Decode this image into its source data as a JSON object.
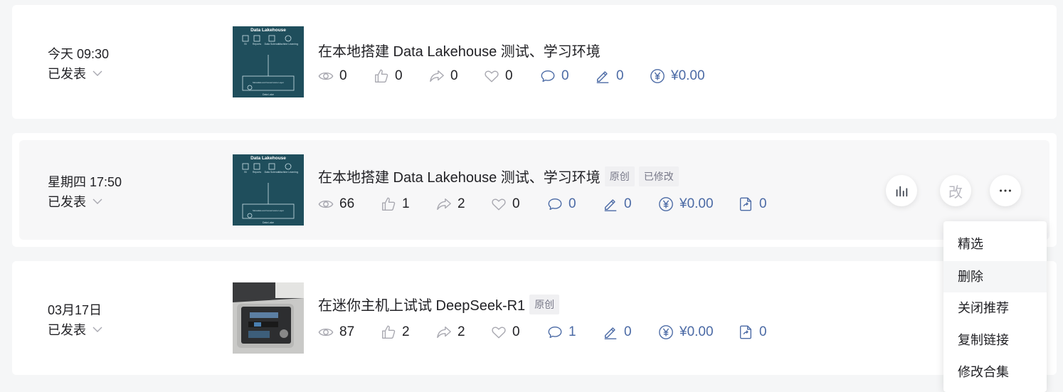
{
  "articles": [
    {
      "date": "今天 09:30",
      "status": "已发表",
      "title": "在本地搭建 Data Lakehouse 测试、学习环境",
      "tags": [],
      "thumb": {
        "kind": "lakehouse",
        "heading": "Data Lakehouse",
        "labels": [
          "BI",
          "Reports",
          "Data Science",
          "Machine Learning"
        ],
        "layer": "Metadata and Governance Layer",
        "footer": "Data Lake"
      },
      "stats": {
        "views": "0",
        "likes": "0",
        "shares": "0",
        "favorites": "0",
        "comments": "0",
        "edits": "0",
        "income": "¥0.00"
      }
    },
    {
      "date": "星期四 17:50",
      "status": "已发表",
      "title": "在本地搭建 Data Lakehouse 测试、学习环境",
      "tags": [
        "原创",
        "已修改"
      ],
      "thumb": {
        "kind": "lakehouse",
        "heading": "Data Lakehouse",
        "labels": [
          "BI",
          "Reports",
          "Data Science",
          "Machine Learning"
        ],
        "layer": "Metadata and Governance Layer",
        "footer": "Data Lake"
      },
      "stats": {
        "views": "66",
        "likes": "1",
        "shares": "2",
        "favorites": "0",
        "comments": "0",
        "edits": "0",
        "income": "¥0.00",
        "exports": "0"
      }
    },
    {
      "date": "03月17日",
      "status": "已发表",
      "title": "在迷你主机上试试 DeepSeek-R1",
      "tags": [
        "原创"
      ],
      "thumb": {
        "kind": "photo"
      },
      "stats": {
        "views": "87",
        "likes": "2",
        "shares": "2",
        "favorites": "0",
        "comments": "1",
        "edits": "0",
        "income": "¥0.00",
        "exports": "0"
      }
    }
  ],
  "actions": {
    "edit_label": "改"
  },
  "menu": {
    "items": [
      "精选",
      "删除",
      "关闭推荐",
      "复制链接",
      "修改合集"
    ],
    "highlighted": "删除"
  },
  "colors": {
    "accent": "#4b6aa5",
    "thumb_bg": "#1f4e5c",
    "page_bg": "#f5f6f7"
  },
  "icons": [
    "eye-icon",
    "thumbs-up-icon",
    "share-icon",
    "heart-icon",
    "comment-icon",
    "pen-icon",
    "yuan-icon",
    "export-icon",
    "bar-chart-icon",
    "more-icon",
    "chevron-down-icon"
  ]
}
